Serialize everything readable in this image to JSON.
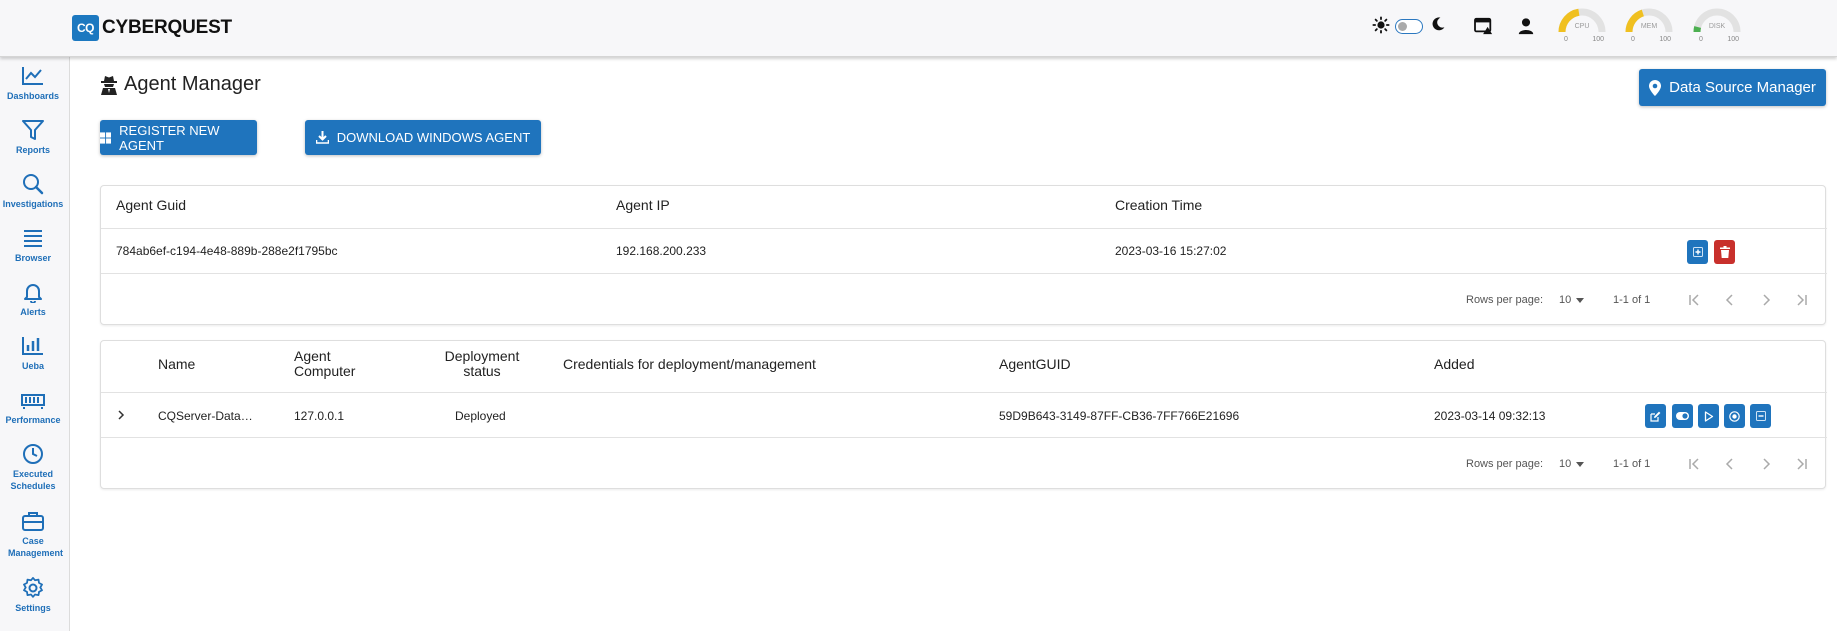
{
  "app": {
    "logo_mark": "CQ",
    "logo_text": "CYBERQUEST"
  },
  "topbar": {
    "icons": [
      "sun-icon",
      "theme-toggle",
      "moon-icon",
      "window-alert-icon",
      "user-icon"
    ],
    "gauges": [
      {
        "label": "CPU",
        "min": "0",
        "max": "100",
        "value": 45,
        "color": "#f0c020"
      },
      {
        "label": "MEM",
        "min": "0",
        "max": "100",
        "value": 40,
        "color": "#f0c020"
      },
      {
        "label": "DISK",
        "min": "0",
        "max": "100",
        "value": 8,
        "color": "#4caf50"
      }
    ]
  },
  "sidebar": {
    "items": [
      {
        "label": "Dashboards",
        "icon": "chart-line-icon"
      },
      {
        "label": "Reports",
        "icon": "filter-icon"
      },
      {
        "label": "Investigations",
        "icon": "search-icon"
      },
      {
        "label": "Browser",
        "icon": "list-icon"
      },
      {
        "label": "Alerts",
        "icon": "bell-icon"
      },
      {
        "label": "Ueba",
        "icon": "chart-bar-icon"
      },
      {
        "label": "Performance",
        "icon": "memory-icon"
      },
      {
        "label": "Executed Schedules",
        "icon": "clock-icon"
      },
      {
        "label": "Case Management",
        "icon": "briefcase-icon"
      },
      {
        "label": "Settings",
        "icon": "gear-icon"
      }
    ]
  },
  "page": {
    "title": "Agent Manager",
    "register_label": "REGISTER NEW AGENT",
    "download_label": "DOWNLOAD WINDOWS AGENT",
    "data_source_label": "Data Source Manager"
  },
  "agents_table": {
    "columns": [
      "Agent Guid",
      "Agent IP",
      "Creation Time"
    ],
    "rows": [
      {
        "guid": "784ab6ef-c194-4e48-889b-288e2f1795bc",
        "ip": "192.168.200.233",
        "created": "2023-03-16 15:27:02"
      }
    ],
    "pagination": {
      "rows_label": "Rows per page:",
      "rows_value": "10",
      "range": "1-1 of 1"
    }
  },
  "sources_table": {
    "columns": [
      "Name",
      "Agent Computer",
      "Deployment status",
      "Credentials for deployment/management",
      "AgentGUID",
      "Added"
    ],
    "rows": [
      {
        "name": "CQServer-Data…",
        "computer": "127.0.0.1",
        "status": "Deployed",
        "credentials": "",
        "agent_guid": "59D9B643-3149-87FF-CB36-7FF766E21696",
        "added": "2023-03-14 09:32:13"
      }
    ],
    "pagination": {
      "rows_label": "Rows per page:",
      "rows_value": "10",
      "range": "1-1 of 1"
    }
  }
}
